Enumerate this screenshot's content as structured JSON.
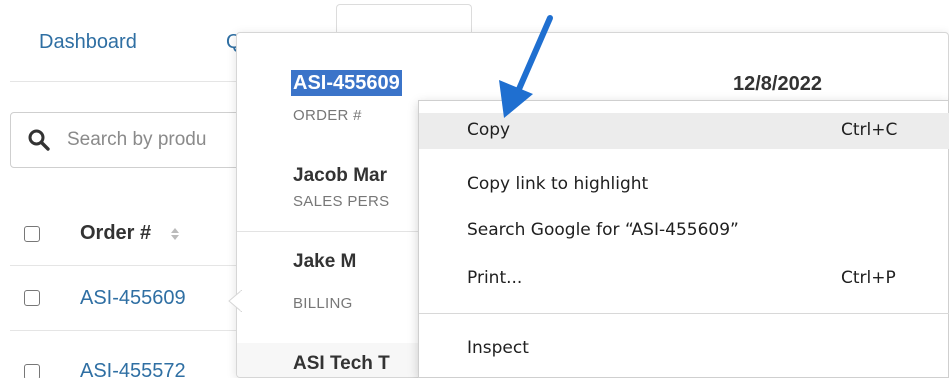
{
  "nav": {
    "dashboard_label": "Dashboard",
    "partial_label": "Q"
  },
  "search": {
    "placeholder": "Search by produ"
  },
  "table": {
    "order_header": "Order #",
    "rows": [
      "ASI-455609",
      "ASI-455572"
    ]
  },
  "popover": {
    "order_number": "ASI-455609",
    "order_label": "ORDER #",
    "date": "12/8/2022",
    "sales_person_name": "Jacob Mar",
    "sales_person_label": "SALES PERS",
    "billing_name": "Jake M",
    "billing_label": "BILLING",
    "next_name": "ASI Tech T"
  },
  "context_menu": {
    "items": [
      {
        "label": "Copy",
        "shortcut": "Ctrl+C"
      },
      {
        "label": "Copy link to highlight",
        "shortcut": ""
      },
      {
        "label": "Search Google for “ASI-455609”",
        "shortcut": ""
      },
      {
        "label": "Print...",
        "shortcut": "Ctrl+P"
      },
      {
        "label": "Inspect",
        "shortcut": ""
      }
    ]
  },
  "colors": {
    "link": "#2f6fa3",
    "selection": "#3b74c9",
    "arrow": "#1f6fd0",
    "menu_hover": "#ececec"
  }
}
